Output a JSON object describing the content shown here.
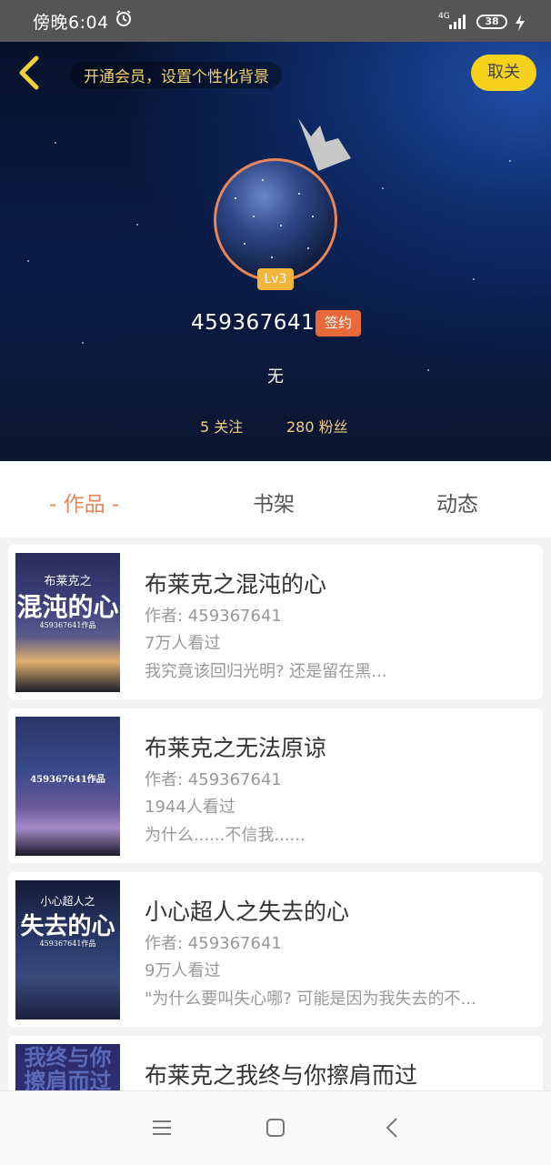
{
  "status_bar": {
    "time": "傍晚6:04",
    "network": "4G",
    "battery": "38"
  },
  "header": {
    "promo_text": "开通会员，设置个性化背景",
    "unfollow_label": "取关",
    "level": "Lv3",
    "username": "459367641",
    "signed_badge": "签约",
    "bio": "无",
    "following": "5 关注",
    "fans": "280 粉丝"
  },
  "tabs": [
    {
      "label": "- 作品 -",
      "active": true
    },
    {
      "label": "书架",
      "active": false
    },
    {
      "label": "动态",
      "active": false
    }
  ],
  "books": [
    {
      "title": "布莱克之混沌的心",
      "author": "作者: 459367641",
      "views": "7万人看过",
      "desc": "我究竟该回归光明? 还是留在黑...",
      "cover_top": "布莱克之",
      "cover_main": "混沌的心",
      "cover_sub": "459367641作品"
    },
    {
      "title": "布莱克之无法原谅",
      "author": "作者: 459367641",
      "views": "1944人看过",
      "desc": "为什么......不信我......",
      "cover_top": "",
      "cover_main": "",
      "cover_sub": "459367641作品"
    },
    {
      "title": "小心超人之失去的心",
      "author": "作者: 459367641",
      "views": "9万人看过",
      "desc": "\"为什么要叫失心哪? 可能是因为我失去的不...",
      "cover_top": "小心超人之",
      "cover_main": "失去的心",
      "cover_sub": "459367641作品"
    },
    {
      "title": "布莱克之我终与你擦肩而过",
      "author": "",
      "views": "",
      "desc": "",
      "cover_top": "",
      "cover_main": "我终与你擦肩而过",
      "cover_sub": ""
    }
  ],
  "colors": {
    "accent": "#e8865a",
    "button_yellow": "#f7d21c",
    "promo_text": "#f5d36a"
  }
}
